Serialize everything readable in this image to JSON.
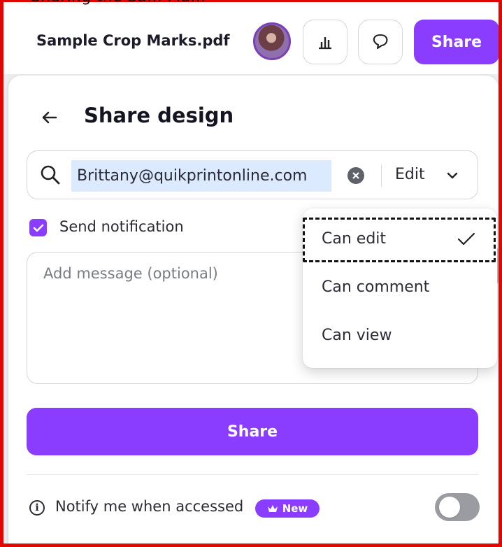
{
  "caption_fragment": "Sharing the Sa... Ma...",
  "file_name": "Sample Crop Marks.pdf",
  "top_bar": {
    "share_label": "Share",
    "analytics_icon": "bar-chart-icon",
    "comment_icon": "speech-bubble-icon",
    "avatar_icon": "user-avatar-icon"
  },
  "panel": {
    "title": "Share design",
    "back_icon": "arrow-left-icon",
    "search_icon": "search-icon",
    "email_value": "Brittany@quikprintonline.com",
    "permission_label": "Edit",
    "send_notification_label": "Send notification",
    "message_placeholder": "Add message (optional)",
    "share_label": "Share",
    "notify_label": "Notify me when accessed",
    "new_badge": "New"
  },
  "dropdown": {
    "items": [
      {
        "label": "Can edit",
        "selected": true
      },
      {
        "label": "Can comment"
      },
      {
        "label": "Can view"
      }
    ]
  },
  "colors": {
    "brand_purple": "#8b3dff",
    "highlight_blue": "#dbeaff",
    "frame_red": "#e10600"
  }
}
